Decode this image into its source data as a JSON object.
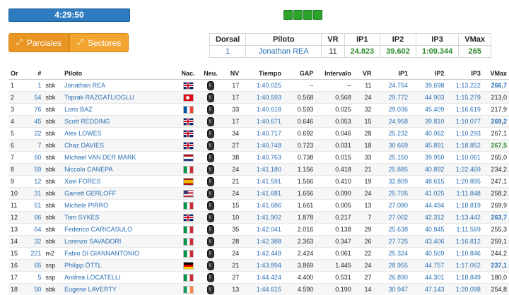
{
  "session": {
    "clock": "4:29:50"
  },
  "tabs": [
    {
      "label": "Parciales",
      "icon": "resize-icon"
    },
    {
      "label": "Sectores",
      "icon": "resize-icon"
    }
  ],
  "summary": {
    "headers": [
      "Dorsal",
      "Piloto",
      "VR",
      "IP1",
      "IP2",
      "IP3",
      "VMax"
    ],
    "row": {
      "dorsal": "1",
      "piloto": "Jonathan REA",
      "vr": "11",
      "ip1": "24.823",
      "ip2": "39.602",
      "ip3": "1:09.344",
      "vmax": "265"
    }
  },
  "table": {
    "headers": [
      "Or",
      "#",
      "",
      "Piloto",
      "Nac.",
      "Neu.",
      "NV",
      "Tiempo",
      "GAP",
      "Intervalo",
      "VR",
      "IP1",
      "IP2",
      "IP3",
      "VMax"
    ],
    "rows": [
      {
        "or": "1",
        "num": "1",
        "cls": "sbk",
        "name": "Jonathan REA",
        "nat": "gb",
        "nv": "17",
        "time": "1:40.025",
        "gap": "--",
        "int": "--",
        "vr": "11",
        "ip1": "24.764",
        "ip2": "39.698",
        "ip3": "1:13.222",
        "vmax": "266,7",
        "vmax_style": "blue"
      },
      {
        "or": "2",
        "num": "54",
        "cls": "sbk",
        "name": "Toprak RAZGATLIOGLU",
        "nat": "tr",
        "nv": "17",
        "time": "1:40.593",
        "gap": "0.568",
        "int": "0.568",
        "vr": "24",
        "ip1": "29.772",
        "ip2": "44.903",
        "ip3": "1:15.279",
        "vmax": "213,0",
        "vmax_style": "plain"
      },
      {
        "or": "3",
        "num": "76",
        "cls": "sbk",
        "name": "Loris BAZ",
        "nat": "fr",
        "nv": "33",
        "time": "1:40.618",
        "gap": "0.593",
        "int": "0.025",
        "vr": "32",
        "ip1": "29.036",
        "ip2": "45.409",
        "ip3": "1:16.619",
        "vmax": "217,9",
        "vmax_style": "plain"
      },
      {
        "or": "4",
        "num": "45",
        "cls": "sbk",
        "name": "Scott REDDING",
        "nat": "gb",
        "nv": "17",
        "time": "1:40.671",
        "gap": "0.646",
        "int": "0.053",
        "vr": "15",
        "ip1": "24.958",
        "ip2": "39.810",
        "ip3": "1:10.077",
        "vmax": "269,2",
        "vmax_style": "blue"
      },
      {
        "or": "5",
        "num": "22",
        "cls": "sbk",
        "name": "Alex LOWES",
        "nat": "gb",
        "nv": "34",
        "time": "1:40.717",
        "gap": "0.692",
        "int": "0.046",
        "vr": "28",
        "ip1": "25.232",
        "ip2": "40.062",
        "ip3": "1:10.293",
        "vmax": "267,1",
        "vmax_style": "plain"
      },
      {
        "or": "6",
        "num": "7",
        "cls": "sbk",
        "name": "Chaz DAVIES",
        "nat": "gb",
        "nv": "27",
        "time": "1:40.748",
        "gap": "0.723",
        "int": "0.031",
        "vr": "18",
        "ip1": "30.669",
        "ip2": "45.891",
        "ip3": "1:18.852",
        "vmax": "267,5",
        "vmax_style": "green"
      },
      {
        "or": "7",
        "num": "60",
        "cls": "sbk",
        "name": "Michael VAN DER MARK",
        "nat": "nl",
        "nv": "38",
        "time": "1:40.763",
        "gap": "0.738",
        "int": "0.015",
        "vr": "33",
        "ip1": "25.150",
        "ip2": "39.950",
        "ip3": "1:10.061",
        "vmax": "265,0",
        "vmax_style": "plain"
      },
      {
        "or": "8",
        "num": "59",
        "cls": "sbk",
        "name": "Niccolo CANEPA",
        "nat": "it",
        "nv": "24",
        "time": "1:41.180",
        "gap": "1.156",
        "int": "0.418",
        "vr": "21",
        "ip1": "25.885",
        "ip2": "40.892",
        "ip3": "1:22.469",
        "vmax": "234,2",
        "vmax_style": "plain"
      },
      {
        "or": "9",
        "num": "12",
        "cls": "sbk",
        "name": "Xavi FORES",
        "nat": "es",
        "nv": "21",
        "time": "1:41.591",
        "gap": "1.566",
        "int": "0.410",
        "vr": "19",
        "ip1": "32.809",
        "ip2": "48.615",
        "ip3": "1:20.895",
        "vmax": "247,1",
        "vmax_style": "plain"
      },
      {
        "or": "10",
        "num": "31",
        "cls": "sbk",
        "name": "Garrett GERLOFF",
        "nat": "us",
        "nv": "24",
        "time": "1:41.681",
        "gap": "1.656",
        "int": "0.090",
        "vr": "24",
        "ip1": "25.705",
        "ip2": "41.025",
        "ip3": "1:11.848",
        "vmax": "258,2",
        "vmax_style": "plain"
      },
      {
        "or": "11",
        "num": "51",
        "cls": "sbk",
        "name": "Michele PIRRO",
        "nat": "it",
        "nv": "15",
        "time": "1:41.686",
        "gap": "1.661",
        "int": "0.005",
        "vr": "13",
        "ip1": "27.080",
        "ip2": "44.494",
        "ip3": "1:18.819",
        "vmax": "269,9",
        "vmax_style": "plain"
      },
      {
        "or": "12",
        "num": "66",
        "cls": "sbk",
        "name": "Tom SYKES",
        "nat": "gb",
        "nv": "10",
        "time": "1:41.902",
        "gap": "1.878",
        "int": "0.217",
        "vr": "7",
        "ip1": "27.002",
        "ip2": "42.312",
        "ip3": "1:13.442",
        "vmax": "263,7",
        "vmax_style": "blue"
      },
      {
        "or": "13",
        "num": "64",
        "cls": "sbk",
        "name": "Federico CARICASULO",
        "nat": "it",
        "nv": "35",
        "time": "1:42.041",
        "gap": "2.016",
        "int": "0.138",
        "vr": "29",
        "ip1": "25.638",
        "ip2": "40.845",
        "ip3": "1:11.569",
        "vmax": "255,3",
        "vmax_style": "plain"
      },
      {
        "or": "14",
        "num": "32",
        "cls": "sbk",
        "name": "Lorenzo SAVADORI",
        "nat": "it",
        "nv": "28",
        "time": "1:42.388",
        "gap": "2.363",
        "int": "0.347",
        "vr": "26",
        "ip1": "27.725",
        "ip2": "43.406",
        "ip3": "1:16.812",
        "vmax": "259,1",
        "vmax_style": "plain"
      },
      {
        "or": "15",
        "num": "221",
        "cls": "m2",
        "name": "Fabio DI GIANNANTONIO",
        "nat": "it",
        "nv": "24",
        "time": "1:42.449",
        "gap": "2.424",
        "int": "0.061",
        "vr": "22",
        "ip1": "25.324",
        "ip2": "40.569",
        "ip3": "1:10.846",
        "vmax": "244,2",
        "vmax_style": "plain"
      },
      {
        "or": "16",
        "num": "65",
        "cls": "ssp",
        "name": "Philipp ÖTTL",
        "nat": "de",
        "nv": "21",
        "time": "1:43.894",
        "gap": "3.869",
        "int": "1.445",
        "vr": "24",
        "ip1": "28.955",
        "ip2": "44.757",
        "ip3": "1:17.062",
        "vmax": "237,1",
        "vmax_style": "blue"
      },
      {
        "or": "17",
        "num": "5",
        "cls": "ssp",
        "name": "Andrea LOCATELLI",
        "nat": "it",
        "nv": "27",
        "time": "1:44.424",
        "gap": "4.400",
        "int": "0.531",
        "vr": "27",
        "ip1": "26.890",
        "ip2": "44.301",
        "ip3": "1:18.849",
        "vmax": "180,0",
        "vmax_style": "plain"
      },
      {
        "or": "18",
        "num": "50",
        "cls": "sbk",
        "name": "Eugene LAVERTY",
        "nat": "ie",
        "nv": "13",
        "time": "1:44.615",
        "gap": "4.590",
        "int": "0.190",
        "vr": "14",
        "ip1": "30.947",
        "ip2": "47.143",
        "ip3": "1:20.098",
        "vmax": "254,8",
        "vmax_style": "plain"
      }
    ]
  }
}
